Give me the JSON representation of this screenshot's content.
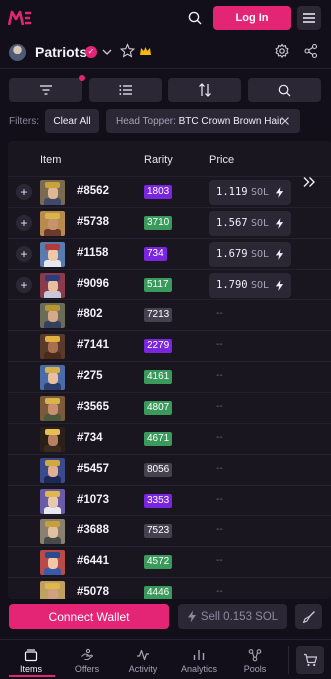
{
  "header": {
    "login_label": "Log In",
    "logo_icon": "magic-eden-logo",
    "colors": {
      "accent": "#e42575",
      "background": "#120f1a",
      "surface": "#2b2735"
    }
  },
  "collection": {
    "name": "Patriots",
    "verified": true
  },
  "filters": {
    "label": "Filters:",
    "clear_label": "Clear All",
    "chips": [
      {
        "key": "Head Topper:",
        "value": "BTC Crown Brown Hair"
      }
    ]
  },
  "table": {
    "columns": {
      "item": "Item",
      "rarity": "Rarity",
      "price": "Price"
    },
    "price_unit": "SOL",
    "rows": [
      {
        "id": "#8562",
        "rarity": "1803",
        "rarity_tier": "purple",
        "price": "1.119",
        "listed": true
      },
      {
        "id": "#5738",
        "rarity": "3710",
        "rarity_tier": "green",
        "price": "1.567",
        "listed": true
      },
      {
        "id": "#1158",
        "rarity": "734",
        "rarity_tier": "purple",
        "price": "1.679",
        "listed": true
      },
      {
        "id": "#9096",
        "rarity": "5117",
        "rarity_tier": "green",
        "price": "1.790",
        "listed": true
      },
      {
        "id": "#802",
        "rarity": "7213",
        "rarity_tier": "gray",
        "price": "--",
        "listed": false
      },
      {
        "id": "#7141",
        "rarity": "2279",
        "rarity_tier": "purple",
        "price": "--",
        "listed": false
      },
      {
        "id": "#275",
        "rarity": "4161",
        "rarity_tier": "green",
        "price": "--",
        "listed": false
      },
      {
        "id": "#3565",
        "rarity": "4807",
        "rarity_tier": "green",
        "price": "--",
        "listed": false
      },
      {
        "id": "#734",
        "rarity": "4671",
        "rarity_tier": "green",
        "price": "--",
        "listed": false
      },
      {
        "id": "#5457",
        "rarity": "8056",
        "rarity_tier": "gray",
        "price": "--",
        "listed": false
      },
      {
        "id": "#1073",
        "rarity": "3353",
        "rarity_tier": "purple",
        "price": "--",
        "listed": false
      },
      {
        "id": "#3688",
        "rarity": "7523",
        "rarity_tier": "gray",
        "price": "--",
        "listed": false
      },
      {
        "id": "#6441",
        "rarity": "4572",
        "rarity_tier": "green",
        "price": "--",
        "listed": false
      },
      {
        "id": "#5078",
        "rarity": "4446",
        "rarity_tier": "green",
        "price": "--",
        "listed": false
      }
    ]
  },
  "actions": {
    "connect_label": "Connect Wallet",
    "sell_label": "Sell 0.153 SOL"
  },
  "nav": {
    "items": [
      {
        "label": "Items",
        "icon": "items-icon"
      },
      {
        "label": "Offers",
        "icon": "offers-icon"
      },
      {
        "label": "Activity",
        "icon": "activity-icon"
      },
      {
        "label": "Analytics",
        "icon": "analytics-icon"
      },
      {
        "label": "Pools",
        "icon": "pools-icon"
      }
    ],
    "active": "Items"
  }
}
